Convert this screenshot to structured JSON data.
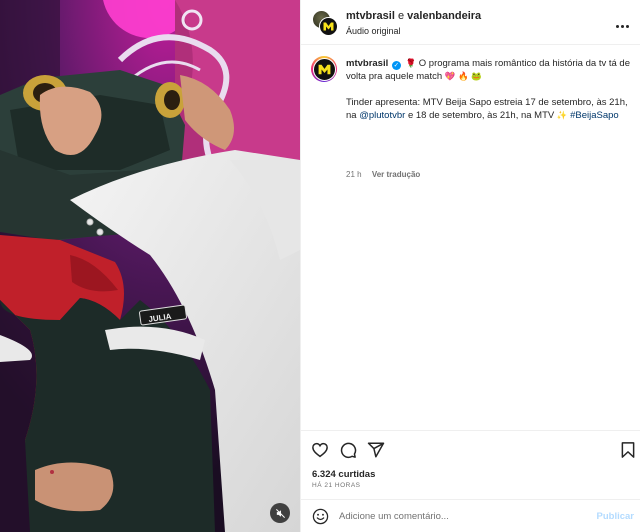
{
  "media": {
    "badge_text": "JULIA",
    "mute_icon": "speaker-muted-icon"
  },
  "header": {
    "user1": "mtvbrasil",
    "separator": "e",
    "user2": "valenbandeira",
    "audio": "Áudio original",
    "more_icon": "more-horizontal-icon"
  },
  "caption": {
    "username": "mtvbrasil",
    "line1_text": "O programa mais romântico da história da tv tá de volta pra aquele match",
    "line2_a": "Tinder apresenta: MTV Beija Sapo estreia 17 de setembro, às 21h, na",
    "mention": "@plutotvbr",
    "line2_b": "e 18 de setembro, às 21h, na MTV",
    "hashtag": "#BeijaSapo",
    "age": "21 h",
    "translate": "Ver tradução"
  },
  "stats": {
    "likes": "6.324 curtidas",
    "time": "HÁ 21 HORAS"
  },
  "comment": {
    "placeholder": "Adicione um comentário...",
    "publish": "Publicar"
  },
  "colors": {
    "accent_blue": "#0095f6",
    "publish_disabled": "#b3dbff",
    "heart": "#e0245e"
  }
}
